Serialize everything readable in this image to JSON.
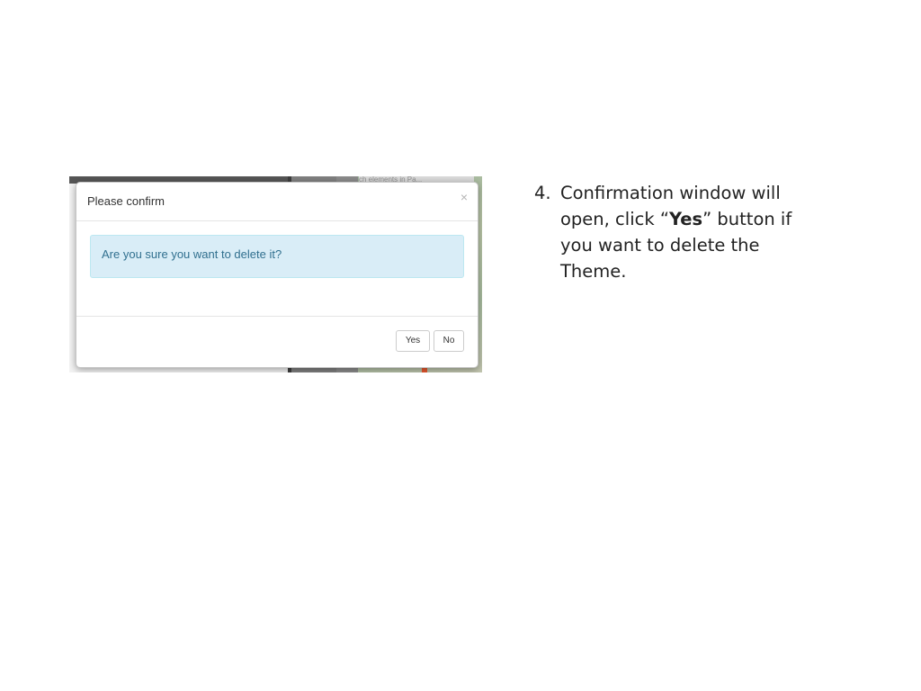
{
  "screenshot": {
    "background_search_text": "ch elements in Pa..."
  },
  "dialog": {
    "title": "Please confirm",
    "close_symbol": "×",
    "message": "Are you sure you want to delete it?",
    "yes_label": "Yes",
    "no_label": "No",
    "alert_color": "#d9edf7",
    "alert_text_color": "#31708f"
  },
  "instruction": {
    "step_number": "4.",
    "text_before": "Confirmation window will open, click “",
    "emphasis": "Yes",
    "text_after": "” button if you want to delete the Theme."
  }
}
